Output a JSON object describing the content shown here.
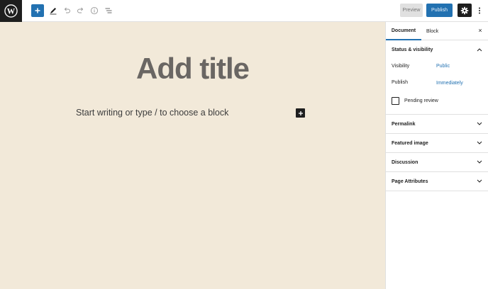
{
  "toolbar": {
    "preview_label": "Preview",
    "publish_label": "Publish"
  },
  "editor": {
    "title_placeholder": "Add title",
    "block_placeholder": "Start writing or type / to choose a block"
  },
  "sidebar": {
    "tabs": [
      {
        "label": "Document",
        "active": true
      },
      {
        "label": "Block",
        "active": false
      }
    ],
    "close_label": "×",
    "status_visibility": {
      "title": "Status & visibility",
      "visibility_label": "Visibility",
      "visibility_value": "Public",
      "publish_label": "Publish",
      "publish_value": "Immediately",
      "pending_review_label": "Pending review",
      "pending_review_checked": false
    },
    "panels": [
      {
        "title": "Permalink"
      },
      {
        "title": "Featured image"
      },
      {
        "title": "Discussion"
      },
      {
        "title": "Page Attributes"
      }
    ]
  },
  "colors": {
    "accent": "#2271b1",
    "canvas_bg": "#f2e9d9",
    "dark": "#1e1e1e"
  },
  "icons": [
    "wordpress-logo",
    "plus-icon",
    "pencil-icon",
    "undo-icon",
    "redo-icon",
    "info-icon",
    "list-view-icon",
    "gear-icon",
    "more-vertical-icon",
    "chevron-up-icon",
    "chevron-down-icon",
    "close-icon"
  ]
}
